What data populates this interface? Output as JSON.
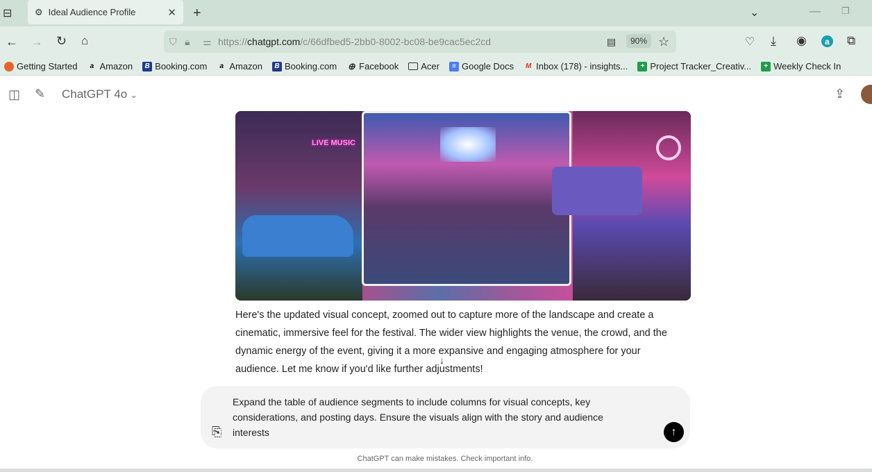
{
  "browser": {
    "tab_title": "Ideal Audience Profile",
    "url_scheme": "https://",
    "url_host": "chatgpt.com",
    "url_path": "/c/66dfbed5-2bb0-8002-bc08-be9cac5ec2cd",
    "zoom": "90%",
    "bookmarks": [
      {
        "label": "Getting Started",
        "icon": "firefox-icon"
      },
      {
        "label": "Amazon",
        "icon": "amazon-icon"
      },
      {
        "label": "Booking.com",
        "icon": "booking-icon"
      },
      {
        "label": "Amazon",
        "icon": "amazon-icon"
      },
      {
        "label": "Booking.com",
        "icon": "booking-icon"
      },
      {
        "label": "Facebook",
        "icon": "globe-icon"
      },
      {
        "label": "Acer",
        "icon": "folder-icon"
      },
      {
        "label": "Google Docs",
        "icon": "docs-icon"
      },
      {
        "label": "Inbox (178) - insights...",
        "icon": "gmail-icon"
      },
      {
        "label": "Project Tracker_Creativ...",
        "icon": "sheets-icon"
      },
      {
        "label": "Weekly Check In",
        "icon": "sheets-icon"
      }
    ]
  },
  "chat": {
    "model": "ChatGPT 4o",
    "response": "Here's the updated visual concept, zoomed out to capture more of the landscape and create a cinematic, immersive feel for the festival. The wider view highlights the venue, the crowd, and the dynamic energy of the event, giving it a more expansive and engaging atmosphere for your audience. Let me know if you'd like further adjustments!",
    "image_signs": "LIVE MUSIC",
    "input_text": "Expand the table of audience segments to include columns for visual concepts, key considerations, and posting days. Ensure the visuals align with the story and audience interests",
    "disclaimer": "ChatGPT can make mistakes. Check important info."
  }
}
